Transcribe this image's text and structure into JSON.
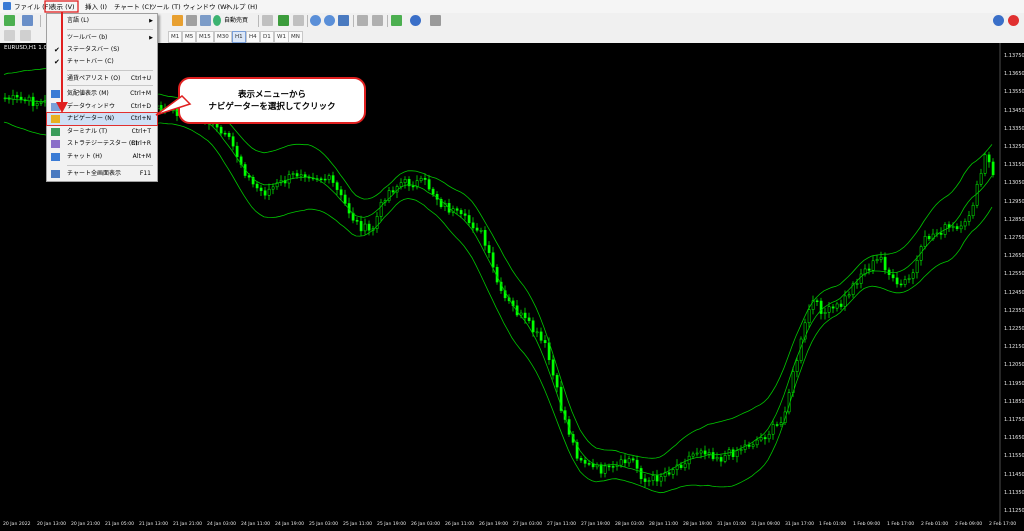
{
  "menubar": {
    "items": [
      "ファイル (F)",
      "表示 (V)",
      "挿入 (I)",
      "チャート (C)",
      "ツール (T)",
      "ウィンドウ (W)",
      "ヘルプ (H)"
    ]
  },
  "toolbar": {
    "autotrade_label": "自動売買",
    "timeframes": [
      "M1",
      "M5",
      "M15",
      "M30",
      "H1",
      "H4",
      "D1",
      "W1",
      "MN"
    ],
    "active_timeframe": "H1"
  },
  "view_menu": {
    "items": [
      {
        "label": "言語 (L)",
        "shortcut": "",
        "submenu": true,
        "checked": false,
        "icon": ""
      },
      {
        "label": "ツールバー (b)",
        "shortcut": "",
        "submenu": true,
        "checked": false,
        "icon": ""
      },
      {
        "label": "ステータスバー (S)",
        "shortcut": "",
        "submenu": false,
        "checked": true,
        "icon": ""
      },
      {
        "label": "チャートバー (C)",
        "shortcut": "",
        "submenu": false,
        "checked": true,
        "icon": ""
      },
      {
        "label": "通貨ペアリスト (O)",
        "shortcut": "Ctrl+U",
        "submenu": false,
        "checked": false,
        "icon": ""
      },
      {
        "label": "気配値表示 (M)",
        "shortcut": "Ctrl+M",
        "submenu": false,
        "checked": false,
        "icon": "market-watch-icon"
      },
      {
        "label": "データウィンドウ",
        "shortcut": "Ctrl+D",
        "submenu": false,
        "checked": false,
        "icon": "data-window-icon"
      },
      {
        "label": "ナビゲーター (N)",
        "shortcut": "Ctrl+N",
        "submenu": false,
        "checked": false,
        "icon": "navigator-icon",
        "highlighted": true
      },
      {
        "label": "ターミナル (T)",
        "shortcut": "Ctrl+T",
        "submenu": false,
        "checked": false,
        "icon": "terminal-icon"
      },
      {
        "label": "ストラテジーテスター (R)",
        "shortcut": "Ctrl+R",
        "submenu": false,
        "checked": false,
        "icon": "tester-icon"
      },
      {
        "label": "チャット (H)",
        "shortcut": "Alt+M",
        "submenu": false,
        "checked": false,
        "icon": "chat-icon"
      },
      {
        "label": "チャート全画面表示",
        "shortcut": "F11",
        "submenu": false,
        "checked": false,
        "icon": "fullscreen-icon"
      }
    ]
  },
  "callout": {
    "line1": "表示メニューから",
    "line2": "ナビゲーターを選択してクリック"
  },
  "chart": {
    "symbol": "EURUSD,H1  1.096",
    "price_ticks": [
      "1.13750",
      "1.13650",
      "1.13550",
      "1.13450",
      "1.13350",
      "1.13250",
      "1.13150",
      "1.13050",
      "1.12950",
      "1.12850",
      "1.12750",
      "1.12650",
      "1.12550",
      "1.12450",
      "1.12350",
      "1.12250",
      "1.12150",
      "1.12050",
      "1.11950",
      "1.11850",
      "1.11750",
      "1.11650",
      "1.11550",
      "1.11450",
      "1.11350",
      "1.11250"
    ],
    "time_ticks": [
      "20 Jan 2022",
      "20 Jan 13:00",
      "20 Jan 21:00",
      "21 Jan 05:00",
      "21 Jan 13:00",
      "21 Jan 21:00",
      "24 Jan 03:00",
      "24 Jan 11:00",
      "24 Jan 19:00",
      "25 Jan 03:00",
      "25 Jan 11:00",
      "25 Jan 19:00",
      "26 Jan 03:00",
      "26 Jan 11:00",
      "26 Jan 19:00",
      "27 Jan 03:00",
      "27 Jan 11:00",
      "27 Jan 19:00",
      "28 Jan 03:00",
      "28 Jan 11:00",
      "28 Jan 19:00",
      "31 Jan 01:00",
      "31 Jan 09:00",
      "31 Jan 17:00",
      "1 Feb 01:00",
      "1 Feb 09:00",
      "1 Feb 17:00",
      "2 Feb 01:00",
      "2 Feb 09:00",
      "2 Feb 17:00"
    ],
    "colors": {
      "background": "#000000",
      "candles": "#00ff00",
      "bands": "#00c800",
      "highlight_box": "#e02020"
    }
  }
}
